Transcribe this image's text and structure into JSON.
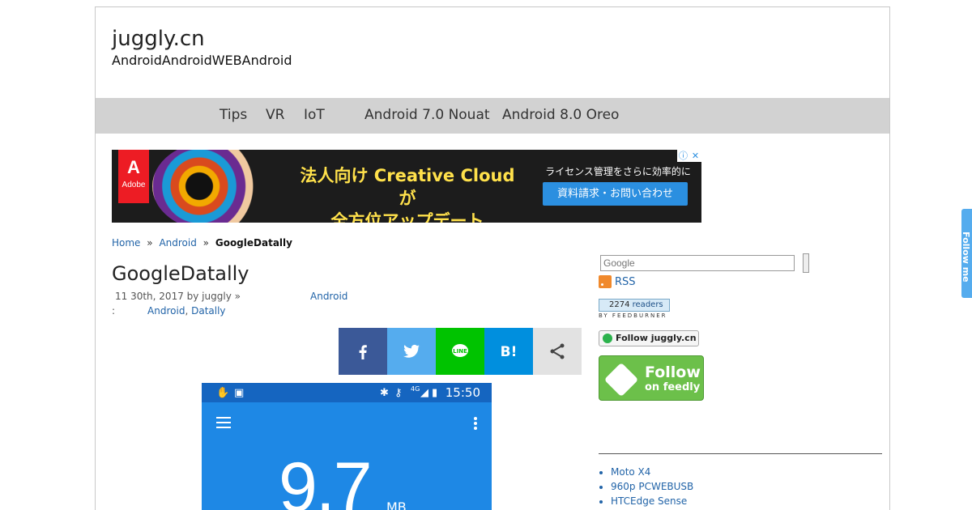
{
  "site": {
    "title": "juggly.cn",
    "description": "AndroidAndroidWEBAndroid"
  },
  "nav": [
    "Tips",
    "VR",
    "IoT",
    "Android 7.0 Nouat",
    "Android 8.0 Oreo"
  ],
  "ad": {
    "brand": "Adobe",
    "headline1": "法人向け Creative Cloud が",
    "headline2": "全方位アップデート",
    "sub": "ライセンス管理をさらに効率的に",
    "button": "資料請求・お問い合わせ",
    "info_icon": "ⓘ",
    "close_icon": "✕"
  },
  "breadcrumb": {
    "home": "Home",
    "sep": "»",
    "category": "Android",
    "current": "GoogleDatally"
  },
  "post": {
    "title": "GoogleDatally",
    "meta": "11 30th, 2017 by juggly  »",
    "category": "Android",
    "tags_prefix": ":",
    "tag1": "Android",
    "tag_sep": ",",
    "tag2": "Datally"
  },
  "share": [
    "facebook",
    "twitter",
    "line",
    "hatena",
    "share"
  ],
  "phone": {
    "time": "15:50",
    "value": "9.7",
    "unit": "MB",
    "net": "4G"
  },
  "sidebar": {
    "search_placeholder": "Google",
    "rss": "RSS",
    "readers_count": "2274",
    "readers_label": "readers",
    "readers_by": "BY FEEDBURNER",
    "follow_small": "Follow juggly.cn",
    "follow_big_1": "Follow",
    "follow_big_2": "on feedly",
    "links": [
      "Moto X4",
      "960p PCWEBUSB",
      "HTCEdge Sense"
    ]
  },
  "follow_tab": "Follow me",
  "colors": {
    "link": "#2264a8",
    "nav_bg": "#d2d2d2",
    "phone_blue": "#1e88e5"
  }
}
